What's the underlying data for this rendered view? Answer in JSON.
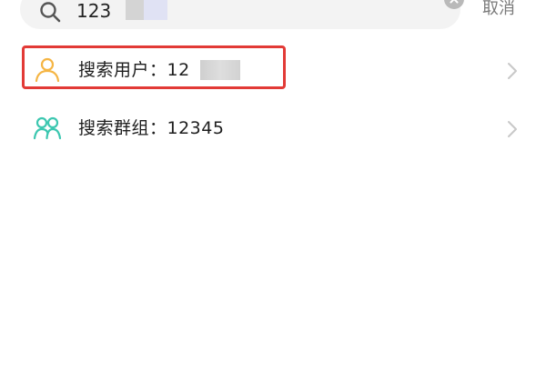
{
  "search": {
    "value": "123",
    "clear_icon": "clear-circle-icon"
  },
  "header": {
    "cancel_label": "取消"
  },
  "results": [
    {
      "label": "搜索用户：12",
      "icon": "user-icon",
      "icon_color": "#f5b544",
      "highlighted": true
    },
    {
      "label": "搜索群组：12345",
      "icon": "group-icon",
      "icon_color": "#3cc7b0",
      "highlighted": false
    }
  ],
  "colors": {
    "highlight_border": "#e23a36",
    "search_bg": "#f3f3f3",
    "chevron": "#c8c8c8"
  }
}
